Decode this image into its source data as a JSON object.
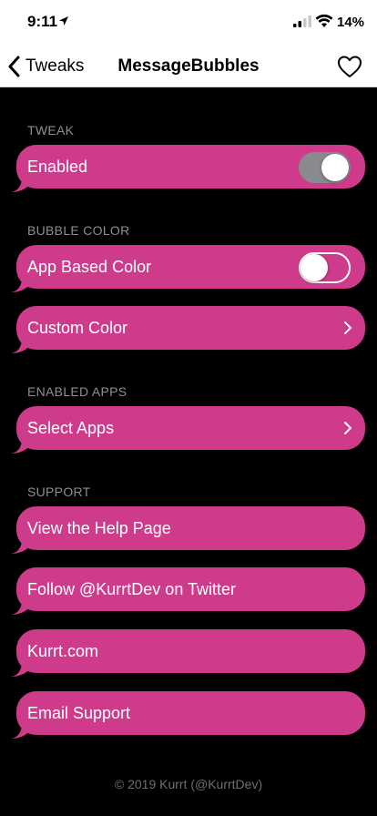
{
  "status_bar": {
    "time": "9:11",
    "battery": "14%"
  },
  "nav": {
    "back_label": "Tweaks",
    "title": "MessageBubbles"
  },
  "sections": {
    "tweak": "TWEAK",
    "bubble_color": "BUBBLE COLOR",
    "enabled_apps": "ENABLED APPS",
    "support": "SUPPORT"
  },
  "rows": {
    "enabled": {
      "label": "Enabled",
      "toggle_on": true
    },
    "app_based_color": {
      "label": "App Based Color",
      "toggle_on": false
    },
    "custom_color": {
      "label": "Custom Color"
    },
    "select_apps": {
      "label": "Select Apps"
    },
    "help_page": {
      "label": "View the Help Page"
    },
    "twitter": {
      "label": "Follow @KurrtDev on Twitter"
    },
    "website": {
      "label": "Kurrt.com"
    },
    "email": {
      "label": "Email Support"
    }
  },
  "footer": "© 2019 Kurrt (@KurrtDev)",
  "colors": {
    "bubble": "#cd3b8a",
    "background": "#000000",
    "header_text": "#8e8e93",
    "toggle_on_track": "#8a8a8e"
  },
  "icons": [
    "location-arrow-icon",
    "signal-icon",
    "wifi-icon",
    "chevron-left-icon",
    "heart-icon",
    "chevron-right-icon"
  ]
}
